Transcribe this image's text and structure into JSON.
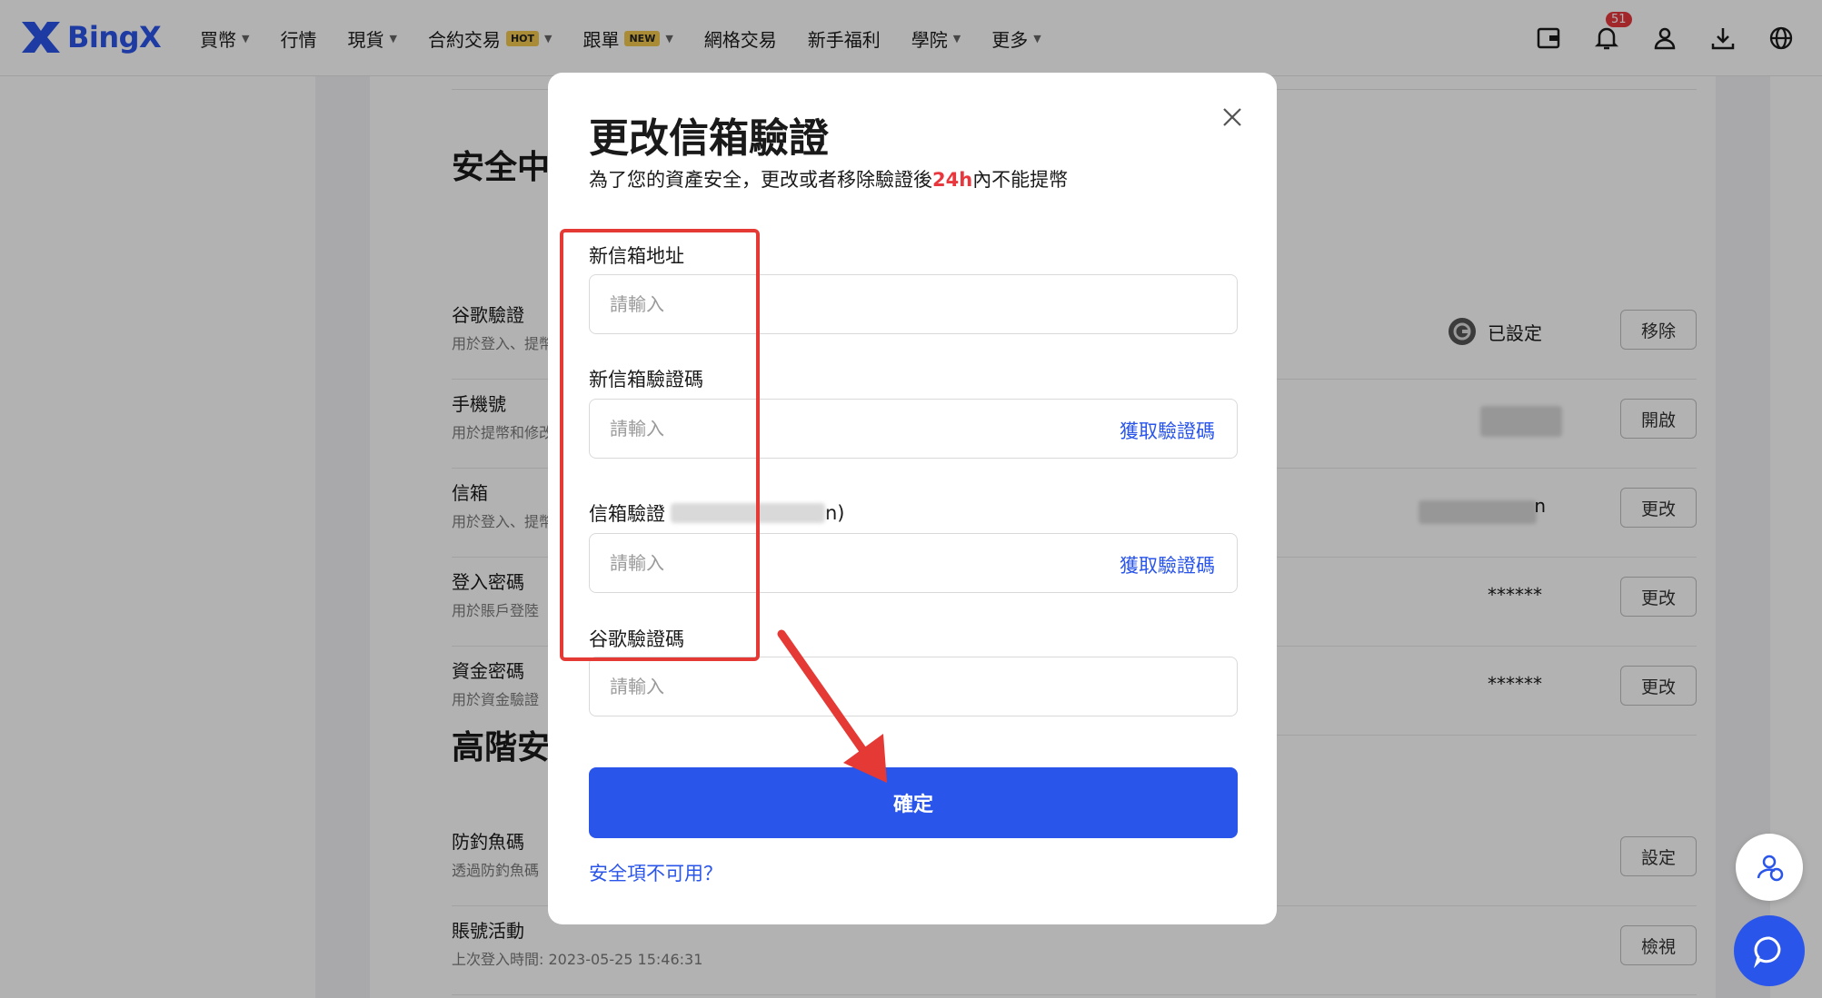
{
  "header": {
    "logo_text": "BingX",
    "nav": [
      {
        "label": "買幣",
        "caret": true
      },
      {
        "label": "行情",
        "caret": false
      },
      {
        "label": "現貨",
        "caret": true
      },
      {
        "label": "合約交易",
        "tag": "HOT",
        "caret": true
      },
      {
        "label": "跟單",
        "tag": "NEW",
        "caret": true
      },
      {
        "label": "網格交易",
        "caret": false
      },
      {
        "label": "新手福利",
        "caret": false
      },
      {
        "label": "學院",
        "caret": true
      },
      {
        "label": "更多",
        "caret": true
      }
    ],
    "notification_count": "51",
    "icons": [
      "wallet-icon",
      "bell-icon",
      "user-icon",
      "download-icon",
      "globe-icon"
    ]
  },
  "page": {
    "security_section_title": "安全中心",
    "advanced_section_title": "高階安全",
    "rows": [
      {
        "title": "谷歌驗證",
        "desc": "用於登入、提幣",
        "status": "已設定",
        "button": "移除"
      },
      {
        "title": "手機號",
        "desc": "用於提幣和修改",
        "status": "",
        "button": "開啟"
      },
      {
        "title": "信箱",
        "desc": "用於登入、提幣",
        "status": "n",
        "button": "更改"
      },
      {
        "title": "登入密碼",
        "desc": "用於賬戶登陸",
        "status": "******",
        "button": "更改"
      },
      {
        "title": "資金密碼",
        "desc": "用於資金驗證",
        "status": "******",
        "button": "更改"
      }
    ],
    "advanced_rows": [
      {
        "title": "防釣魚碼",
        "desc": "透過防釣魚碼",
        "button": "設定"
      },
      {
        "title": "賬號活動",
        "desc": "上次登入時間: 2023-05-25 15:46:31",
        "button": "檢視"
      }
    ]
  },
  "modal": {
    "title": "更改信箱驗證",
    "notice_before": "為了您的資產安全，更改或者移除驗證後",
    "notice_highlight": "24h",
    "notice_after": "內不能提幣",
    "fields": [
      {
        "label": "新信箱地址",
        "placeholder": "請輸入"
      },
      {
        "label": "新信箱驗證碼",
        "placeholder": "請輸入",
        "link": "獲取驗證碼"
      },
      {
        "label": "信箱驗證",
        "label_suffix": "n)",
        "placeholder": "請輸入",
        "link": "獲取驗證碼"
      },
      {
        "label": "谷歌驗證碼",
        "placeholder": "請輸入"
      }
    ],
    "confirm_label": "確定",
    "unavailable_link": "安全項不可用？"
  },
  "colors": {
    "brand": "#2a55ea",
    "highlight": "#e8383d",
    "annotation": "#e53935"
  }
}
